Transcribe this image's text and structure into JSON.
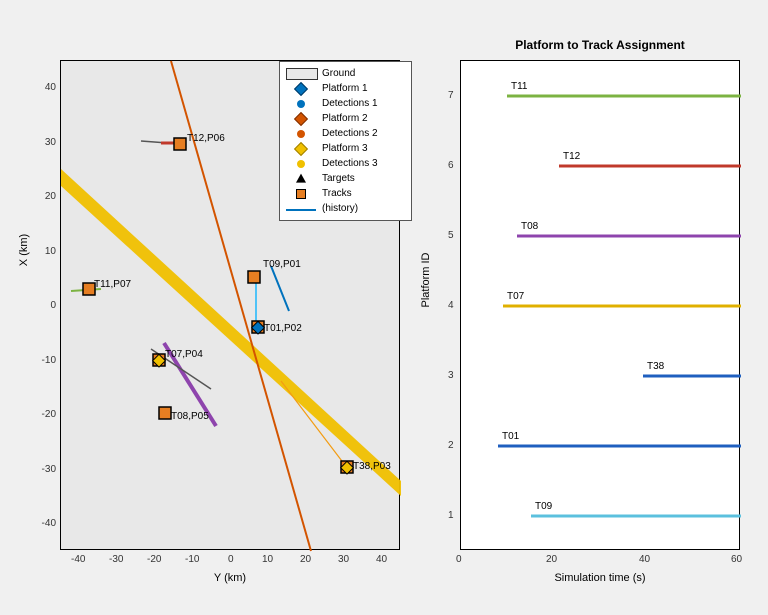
{
  "chart_data": [
    {
      "type": "scatter",
      "title": "",
      "xlabel": "Y (km)",
      "ylabel": "X (km)",
      "xlim": [
        -45,
        45
      ],
      "ylim": [
        -45,
        45
      ],
      "xticks": [
        -40,
        -30,
        -20,
        -10,
        0,
        10,
        20,
        30,
        40
      ],
      "yticks": [
        -40,
        -30,
        -20,
        -10,
        0,
        10,
        20,
        30,
        40
      ],
      "legend": [
        "Ground",
        "Platform 1",
        "Detections 1",
        "Platform 2",
        "Detections 2",
        "Platform 3",
        "Detections 3",
        "Targets",
        "Tracks",
        "(history)"
      ],
      "tracks": [
        {
          "label": "T09,P01",
          "y": 6,
          "x": 5
        },
        {
          "label": "T01,P02",
          "y": 7,
          "x": -4
        },
        {
          "label": "T38,P03",
          "y": 31,
          "x": -30
        },
        {
          "label": "T07,P04",
          "y": -19,
          "x": -10
        },
        {
          "label": "T08,P05",
          "y": -18,
          "x": -20
        },
        {
          "label": "T12,P06",
          "y": -14,
          "x": 30
        },
        {
          "label": "T11,P07",
          "y": -37,
          "x": 3
        }
      ]
    },
    {
      "type": "line",
      "title": "Platform to Track Assignment",
      "xlabel": "Simulation time (s)",
      "ylabel": "Platform ID",
      "xlim": [
        0,
        60
      ],
      "ylim": [
        0.5,
        7.5
      ],
      "xticks": [
        0,
        20,
        40,
        60
      ],
      "yticks": [
        1,
        2,
        3,
        4,
        5,
        6,
        7
      ],
      "series": [
        {
          "name": "T09",
          "platform": 1,
          "start": 15,
          "end": 60,
          "color": "#5bc0de"
        },
        {
          "name": "T01",
          "platform": 2,
          "start": 8,
          "end": 60,
          "color": "#1f5fbf"
        },
        {
          "name": "T38",
          "platform": 3,
          "start": 39,
          "end": 60,
          "color": "#1f5fbf"
        },
        {
          "name": "T07",
          "platform": 4,
          "start": 9,
          "end": 60,
          "color": "#e0b000"
        },
        {
          "name": "T08",
          "platform": 5,
          "start": 12,
          "end": 60,
          "color": "#8e44ad"
        },
        {
          "name": "T12",
          "platform": 6,
          "start": 21,
          "end": 60,
          "color": "#c0392b"
        },
        {
          "name": "T11",
          "platform": 7,
          "start": 10,
          "end": 60,
          "color": "#7cb342"
        }
      ]
    }
  ],
  "left": {
    "xlabel": "Y (km)",
    "ylabel": "X (km)"
  },
  "right": {
    "title": "Platform to Track Assignment",
    "xlabel": "Simulation time (s)",
    "ylabel": "Platform ID"
  },
  "legend_labels": {
    "ground": "Ground",
    "p1": "Platform 1",
    "d1": "Detections 1",
    "p2": "Platform 2",
    "d2": "Detections 2",
    "p3": "Platform 3",
    "d3": "Detections 3",
    "tg": "Targets",
    "tr": "Tracks",
    "hi": "(history)"
  },
  "track_labels": {
    "t09": "T09,P01",
    "t01": "T01,P02",
    "t38": "T38,P03",
    "t07": "T07,P04",
    "t08": "T08,P05",
    "t12": "T12,P06",
    "t11": "T11,P07"
  },
  "assign_labels": {
    "p1": "T09",
    "p2": "T01",
    "p3": "T38",
    "p4": "T07",
    "p5": "T08",
    "p6": "T12",
    "p7": "T11"
  },
  "xt_left": {
    "m40": "-40",
    "m30": "-30",
    "m20": "-20",
    "m10": "-10",
    "z": "0",
    "p10": "10",
    "p20": "20",
    "p30": "30",
    "p40": "40"
  },
  "yt_left": {
    "m40": "-40",
    "m30": "-30",
    "m20": "-20",
    "m10": "-10",
    "z": "0",
    "p10": "10",
    "p20": "20",
    "p30": "30",
    "p40": "40"
  },
  "xt_right": {
    "t0": "0",
    "t20": "20",
    "t40": "40",
    "t60": "60"
  },
  "yt_right": {
    "y1": "1",
    "y2": "2",
    "y3": "3",
    "y4": "4",
    "y5": "5",
    "y6": "6",
    "y7": "7"
  }
}
